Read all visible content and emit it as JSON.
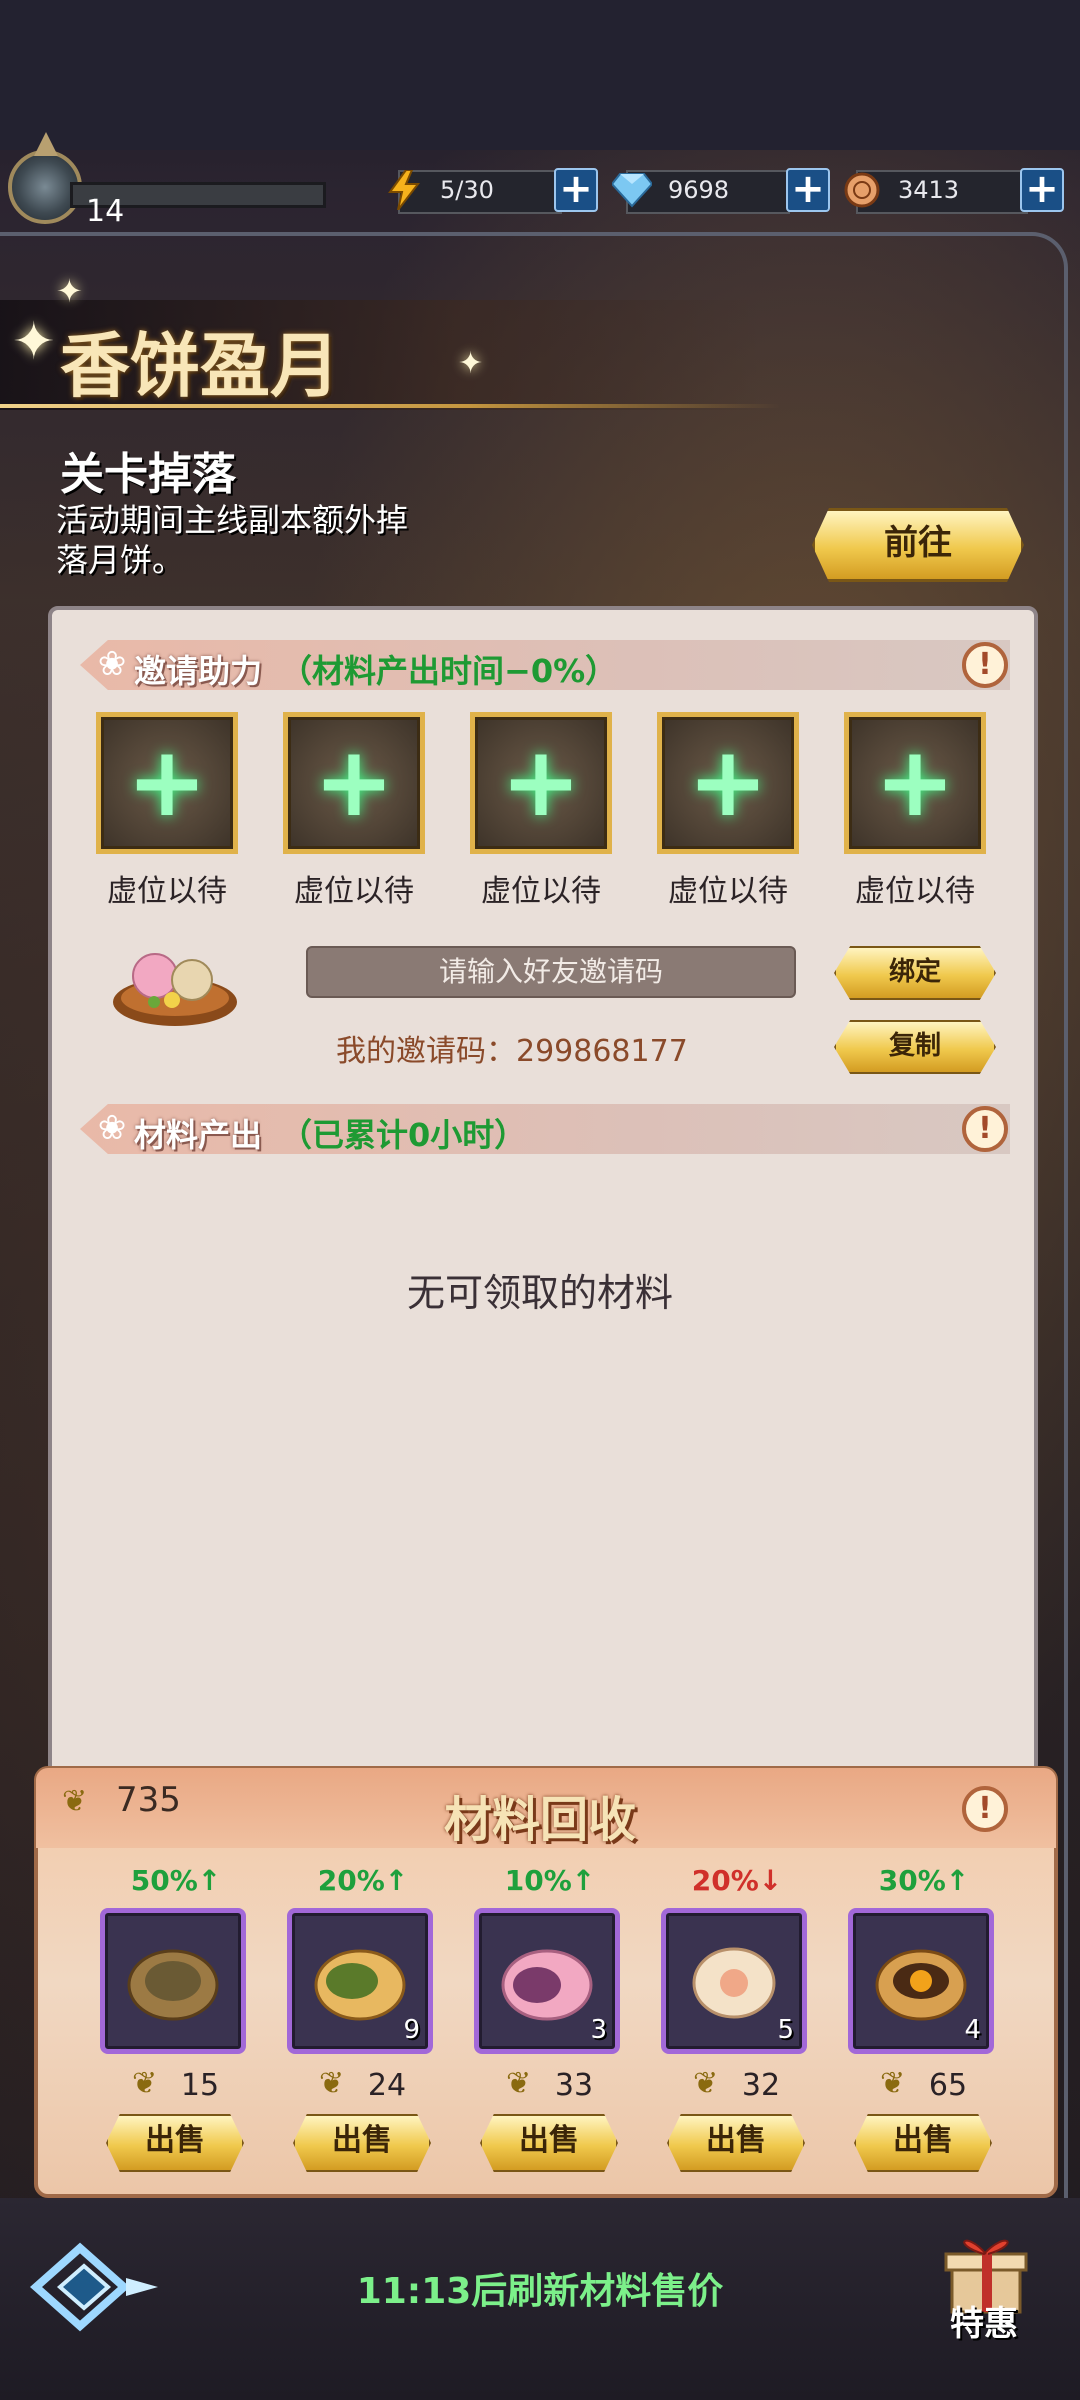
{
  "header": {
    "level": "14",
    "energy": "5/30",
    "diamonds": "9698",
    "coins": "3413"
  },
  "event": {
    "title": "香饼盈月",
    "drop_title": "关卡掉落",
    "drop_desc": "活动期间主线副本额外掉落月饼。",
    "goto_label": "前往"
  },
  "invite": {
    "section_label": "邀请助力",
    "section_note": "（材料产出时间−0%）",
    "slots": [
      "虚位以待",
      "虚位以待",
      "虚位以待",
      "虚位以待",
      "虚位以待"
    ],
    "input_placeholder": "请输入好友邀请码",
    "bind_label": "绑定",
    "copy_label": "复制",
    "my_code": "我的邀请码：299868177"
  },
  "output": {
    "section_label": "材料产出",
    "section_note": "（已累计0小时）",
    "empty_text": "无可领取的材料"
  },
  "recycle": {
    "title": "材料回收",
    "currency_count": "735",
    "items": [
      {
        "pct": "50%↑",
        "trend": "up",
        "qty": "",
        "price": "15",
        "sell": "出售"
      },
      {
        "pct": "20%↑",
        "trend": "up",
        "qty": "9",
        "price": "24",
        "sell": "出售"
      },
      {
        "pct": "10%↑",
        "trend": "up",
        "qty": "3",
        "price": "33",
        "sell": "出售"
      },
      {
        "pct": "20%↓",
        "trend": "down",
        "qty": "5",
        "price": "32",
        "sell": "出售"
      },
      {
        "pct": "30%↑",
        "trend": "up",
        "qty": "4",
        "price": "65",
        "sell": "出售"
      }
    ]
  },
  "footer": {
    "refresh_text": "11:13后刷新材料售价",
    "gift_label": "特惠"
  }
}
